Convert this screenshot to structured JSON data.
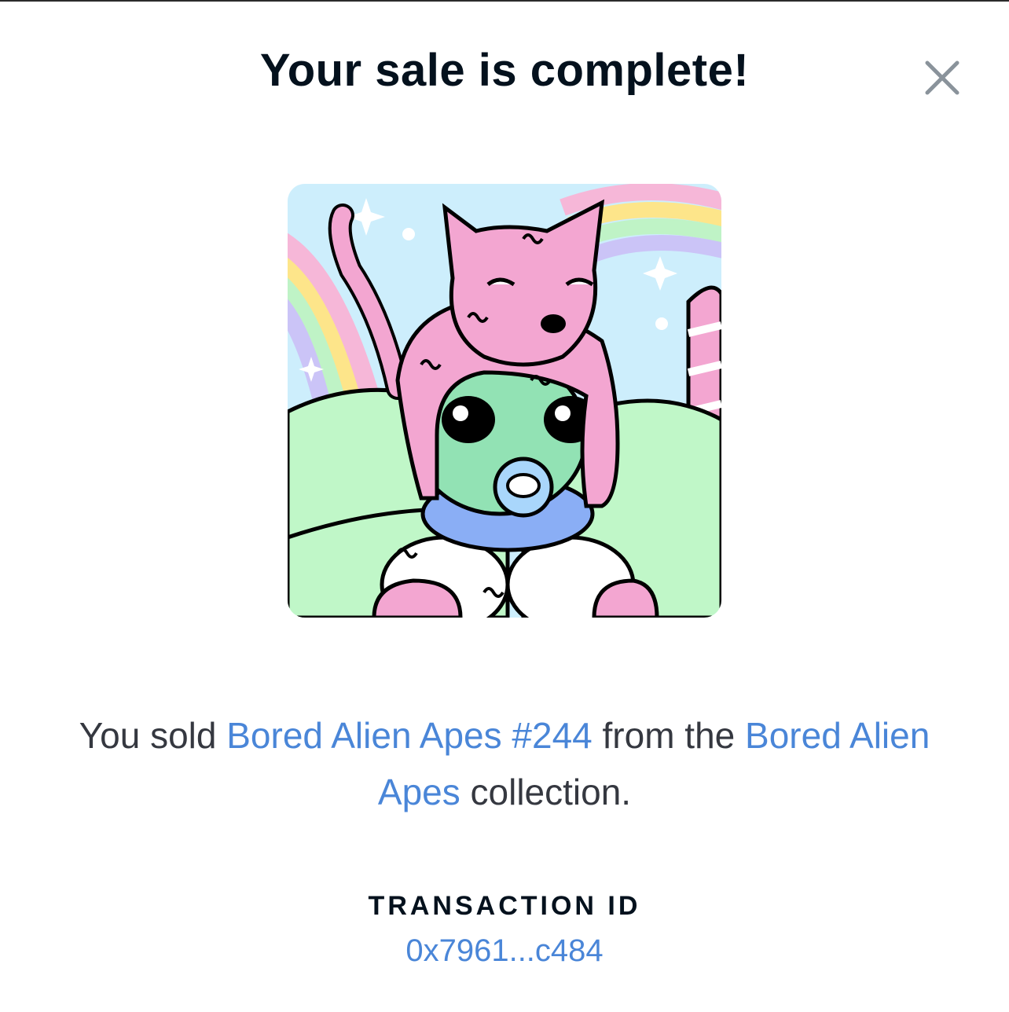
{
  "dialog": {
    "title": "Your sale is complete!",
    "close_icon": "close-icon"
  },
  "nft": {
    "image_description_icon": "nft-artwork"
  },
  "message": {
    "prefix": "You sold ",
    "item_link": "Bored Alien Apes #244",
    "middle": " from the ",
    "collection_link": "Bored Alien Apes",
    "suffix": " collection."
  },
  "transaction": {
    "label": "TRANSACTION ID",
    "id": "0x7961...c484"
  },
  "colors": {
    "title": "#04111d",
    "link": "#4a86d8",
    "body_text": "#353840",
    "close": "#8a939b"
  }
}
